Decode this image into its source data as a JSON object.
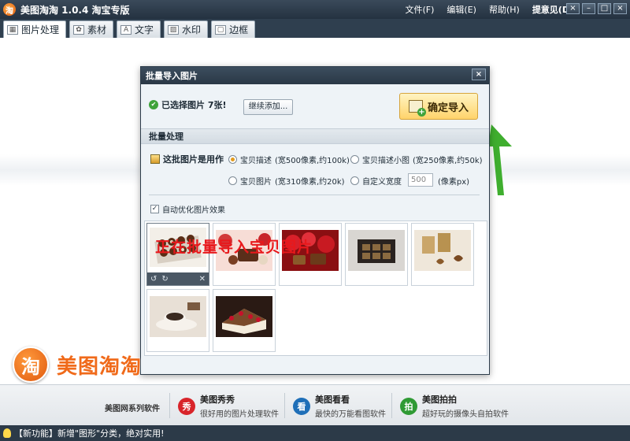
{
  "window": {
    "logo_char": "淘",
    "title": "美图淘淘 1.0.4 淘宝专版",
    "menu": [
      "文件(F)",
      "编辑(E)",
      "帮助(H)"
    ],
    "feedback": "提意见(D)",
    "controls": [
      "×",
      "–",
      "□",
      "×"
    ]
  },
  "tabs": [
    {
      "label": "图片处理",
      "icon": "picture-icon"
    },
    {
      "label": "素材",
      "icon": "sticker-icon"
    },
    {
      "label": "文字",
      "icon": "text-icon"
    },
    {
      "label": "水印",
      "icon": "watermark-icon"
    },
    {
      "label": "边框",
      "icon": "frame-icon"
    }
  ],
  "dialog": {
    "title": "批量导入图片",
    "close": "×",
    "selected_text": "已选择图片 7张!",
    "add_more": "继续添加...",
    "confirm_import": "确定导入",
    "section_title": "批量处理",
    "use_label": "这批图片是用作",
    "options": [
      {
        "label": "宝贝描述",
        "note": "(宽500像素,约100k)",
        "checked": true
      },
      {
        "label": "宝贝描述小图",
        "note": "(宽250像素,约50k)",
        "checked": false
      },
      {
        "label": "宝贝图片",
        "note": "(宽310像素,约20k)",
        "checked": false
      },
      {
        "label": "自定义宽度",
        "note": "",
        "checked": false
      }
    ],
    "custom_width": "500",
    "unit": "(像素px)",
    "auto_optimize": "自动优化图片效果",
    "auto_optimize_checked": true,
    "thumb_tools": {
      "rotate_left": "↺",
      "rotate_right": "↻",
      "delete": "✕"
    },
    "thumbnails": [
      {
        "name": "chocolate-tray",
        "colors": [
          "#f3efe8",
          "#6b3a1e",
          "#3a1e10"
        ]
      },
      {
        "name": "chocolate-roses",
        "colors": [
          "#f7d6d0",
          "#d23a3a",
          "#5a2e1a"
        ]
      },
      {
        "name": "red-roses-chocolate",
        "colors": [
          "#8a0f12",
          "#d8202a",
          "#6b3a1a"
        ]
      },
      {
        "name": "chocolate-gift-box",
        "colors": [
          "#d9d6d2",
          "#2a2320",
          "#8a6a40"
        ]
      },
      {
        "name": "tea-cans-heart-cookies",
        "colors": [
          "#efe7da",
          "#caa66a",
          "#7a4a22"
        ]
      },
      {
        "name": "coffee-cup",
        "colors": [
          "#e8e0d6",
          "#3a2a20",
          "#7a5a40"
        ]
      },
      {
        "name": "strawberry-cake",
        "colors": [
          "#2a1a14",
          "#f4ecdc",
          "#c8102a"
        ]
      }
    ]
  },
  "overlay_caption": "正在批量导入宝贝图片",
  "brand": {
    "badge": "淘",
    "text": "美图淘淘"
  },
  "bottom": {
    "series_label": "美图网系列软件",
    "software": [
      {
        "name": "美图秀秀",
        "desc": "很好用的图片处理软件",
        "icon_char": "秀",
        "color": "#d8242a"
      },
      {
        "name": "美图看看",
        "desc": "最快的万能看图软件",
        "icon_char": "看",
        "color": "#1f6fb8"
      },
      {
        "name": "美图拍拍",
        "desc": "超好玩的摄像头自拍软件",
        "icon_char": "拍",
        "color": "#2f9a34"
      }
    ]
  },
  "status": "【新功能】新增\"图形\"分类，绝对实用!"
}
